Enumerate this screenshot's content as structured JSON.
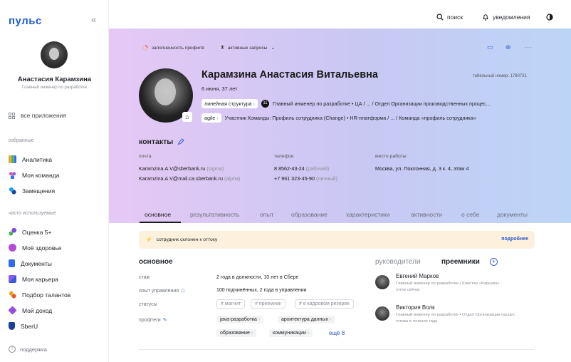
{
  "app": {
    "logo": "пульс",
    "collapse": "«"
  },
  "sidebar": {
    "user_name": "Анастасия Карамзина",
    "user_role": "Главный инженер по разработке",
    "all_apps": "все приложения",
    "favorites_title": "избранные",
    "favorites": [
      {
        "label": "Аналитика",
        "icon": "analytics-icon",
        "color": "#e9a21a"
      },
      {
        "label": "Моя команда",
        "icon": "team-icon",
        "color": "#8a5cf6"
      },
      {
        "label": "Замещения",
        "icon": "substitution-icon",
        "color": "#1fa2e0"
      }
    ],
    "frequent_title": "часто используемые",
    "frequent": [
      {
        "label": "Оценка 5+",
        "icon": "rating-icon",
        "color": "#7c4ddc"
      },
      {
        "label": "Моё здоровье",
        "icon": "health-icon",
        "color": "#b44bd6"
      },
      {
        "label": "Документы",
        "icon": "documents-icon",
        "color": "#2f6ee8"
      },
      {
        "label": "Моя карьера",
        "icon": "career-icon",
        "color": "#3a5bd9"
      },
      {
        "label": "Подбор талантов",
        "icon": "talents-icon",
        "color": "#e05a2b"
      },
      {
        "label": "Мой доход",
        "icon": "income-icon",
        "color": "#9a4de0"
      },
      {
        "label": "SberU",
        "icon": "sberu-icon",
        "color": "#1b3f9e"
      }
    ],
    "support": "поддержка"
  },
  "header": {
    "search": "поиск",
    "notifications": "уведомления"
  },
  "toolbar": {
    "completeness": "заполненность профиля",
    "requests": "активные запросы"
  },
  "profile": {
    "full_name": "Карамзина Анастасия Витальевна",
    "birth": "6 июня, 37 лет",
    "tab_number": "табельный номер: 1780731",
    "line1": {
      "chip": "линейная структура",
      "num": "11",
      "text": "Главный инженер по разработке • ЦА / ... / Отдел Организации производственных процес..."
    },
    "line2": {
      "chip": "agile",
      "text": "Участник Команды: Профиль сотрудника (Change) • HR-платформа / ... / Команда «профиль сотрудника»"
    }
  },
  "contacts": {
    "title": "контакты",
    "mail_label": "почта",
    "mail1": "Karamzina.A.V@sberbank.ru",
    "mail1_note": "(sigma)",
    "mail2": "Karamzina.A.V@mail.ca.sberbank.ru",
    "mail2_note": "(alpha)",
    "phone_label": "телефон",
    "phone1": "8 8562-43-24",
    "phone1_note": "(рабочий)",
    "phone2": "+7 961 323-45-90",
    "phone2_note": "(личный)",
    "work_label": "место работы",
    "work": "Москва, ул. Поклонная, д. 3 к. 4, этаж 4"
  },
  "tabs": [
    "основное",
    "результативность",
    "опыт",
    "образование",
    "характеристики",
    "активности",
    "о себе",
    "документы"
  ],
  "alert": {
    "text": "сотрудник склонен к оттоку",
    "more": "подробнее"
  },
  "main": {
    "title": "основное",
    "rows": [
      {
        "label": "стаж",
        "value": "2 года в должности, 10 лет в Сбере"
      },
      {
        "label": "опыт управления",
        "value": "100 подчинённых, 2 года в управлении"
      }
    ],
    "status_label": "статусы",
    "statuses": [
      "# магнит",
      "# преемник",
      "# в кадровом резерве"
    ],
    "proftags_label": "профтеги",
    "proftags": [
      "java-разработка",
      "архитектура данных",
      "образование",
      "коммуникации"
    ],
    "more_tags": "ещё 8"
  },
  "side": {
    "managers_title": "руководители",
    "successors_title": "преемники",
    "people": [
      {
        "name": "Евгений Марков",
        "role": "Главный инженер по разработке • Кластер «Карьера»",
        "status": "готов сейчас"
      },
      {
        "name": "Виктория Волк",
        "role": "Главный инженер по разработке • Отдел Организации процес",
        "status": "готова в течение года"
      }
    ]
  }
}
